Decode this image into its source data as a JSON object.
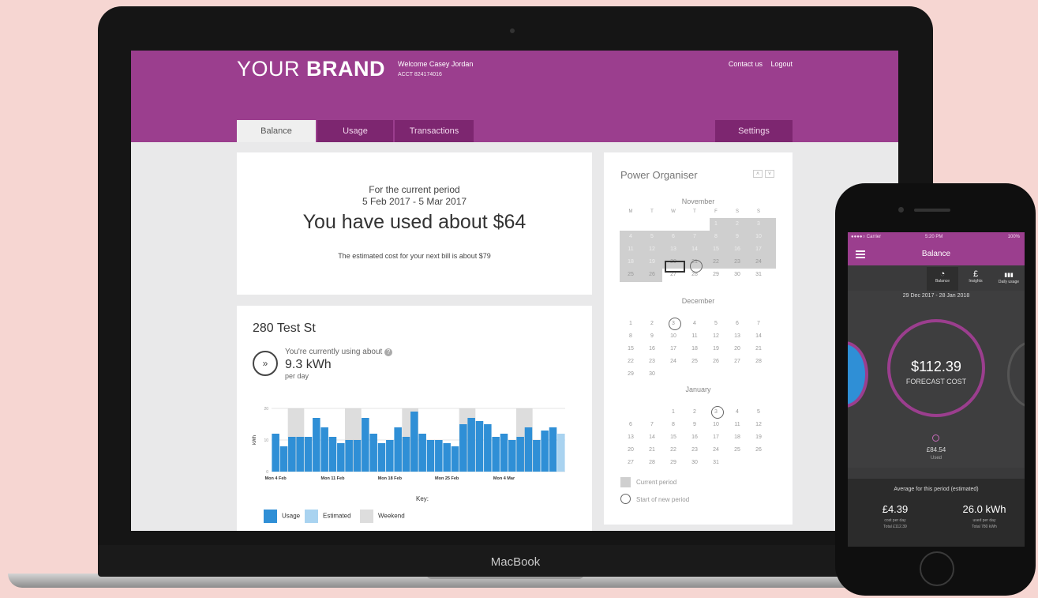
{
  "laptop": {
    "brand_label": "MacBook"
  },
  "site": {
    "brand_light": "YOUR",
    "brand_bold": "BRAND",
    "welcome": "Welcome Casey Jordan",
    "account": "ACCT 824174016",
    "links": [
      "Contact us",
      "Logout"
    ],
    "tabs": [
      "Balance",
      "Usage",
      "Transactions"
    ],
    "settings_tab": "Settings"
  },
  "period_card": {
    "label": "For the current period",
    "dates": "5 Feb 2017 - 5 Mar 2017",
    "headline": "You have used about $64",
    "estimate": "The estimated cost for your next bill is about $79"
  },
  "usage_card": {
    "address": "280 Test St",
    "currently_label": "You're currently using about",
    "arrow_icon": "»",
    "value": "9.3 kWh",
    "per": "per day",
    "legend_key": "Key:",
    "legend": [
      "Usage",
      "Estimated",
      "Weekend"
    ]
  },
  "chart_data": {
    "type": "bar",
    "ylabel": "kWh",
    "ylim": [
      0,
      20
    ],
    "yticks": [
      "20",
      "10",
      "0"
    ],
    "xticks": [
      "Mon 4 Feb",
      "Mon 11 Feb",
      "Mon 18 Feb",
      "Mon 25 Feb",
      "Mon 4 Mar"
    ],
    "values": [
      12,
      8,
      11,
      11,
      11,
      17,
      14,
      11,
      9,
      10,
      10,
      17,
      12,
      9,
      10,
      14,
      11,
      19,
      12,
      10,
      10,
      9,
      8,
      15,
      17,
      16,
      15,
      11,
      12,
      10,
      11,
      14,
      10,
      13,
      14,
      12
    ],
    "estimated_index": 35,
    "weekend_bands": [
      [
        2,
        3
      ],
      [
        9,
        10
      ],
      [
        16,
        17
      ],
      [
        23,
        24
      ],
      [
        30,
        31
      ]
    ],
    "colors": {
      "usage": "#2f8fd6",
      "estimated": "#a9d3f0",
      "weekend": "#dddddd"
    }
  },
  "calendar": {
    "title": "Power Organiser",
    "weekdays": [
      "M",
      "T",
      "W",
      "T",
      "F",
      "S",
      "S"
    ],
    "months": [
      {
        "name": "November",
        "rows": [
          [
            "",
            "",
            "",
            "",
            "1",
            "2",
            "3"
          ],
          [
            "4",
            "5",
            "6",
            "7",
            "8",
            "9",
            "10"
          ],
          [
            "11",
            "12",
            "13",
            "14",
            "15",
            "16",
            "17"
          ],
          [
            "18",
            "19",
            "20",
            "21",
            "22",
            "23",
            "24"
          ],
          [
            "25",
            "26",
            "27",
            "28",
            "29",
            "30",
            "31"
          ]
        ]
      },
      {
        "name": "December",
        "rows": [
          [
            "1",
            "2",
            "3",
            "4",
            "5",
            "6",
            "7"
          ],
          [
            "8",
            "9",
            "10",
            "11",
            "12",
            "13",
            "14"
          ],
          [
            "15",
            "16",
            "17",
            "18",
            "19",
            "20",
            "21"
          ],
          [
            "22",
            "23",
            "24",
            "25",
            "26",
            "27",
            "28"
          ],
          [
            "29",
            "30",
            "",
            "",
            "",
            "",
            ""
          ]
        ]
      },
      {
        "name": "January",
        "rows": [
          [
            "",
            "",
            "1",
            "2",
            "3",
            "4",
            "5"
          ],
          [
            "6",
            "7",
            "8",
            "9",
            "10",
            "11",
            "12"
          ],
          [
            "13",
            "14",
            "15",
            "16",
            "17",
            "18",
            "19"
          ],
          [
            "20",
            "21",
            "22",
            "23",
            "24",
            "25",
            "26"
          ],
          [
            "27",
            "28",
            "29",
            "30",
            "31",
            "",
            ""
          ]
        ]
      }
    ],
    "legend_current": "Current period",
    "legend_start": "Start of new period"
  },
  "phone": {
    "carrier": "●●●●○ Carrier",
    "time": "5:20 PM",
    "battery": "100%",
    "title": "Balance",
    "tabs": [
      {
        "label": "Balance",
        "glyph": "◔"
      },
      {
        "label": "Insights",
        "glyph": "£"
      },
      {
        "label": "Daily usage",
        "glyph": "▮▮▮"
      }
    ],
    "period": "29 Dec 2017 - 28 Jan 2018",
    "forecast_value": "$112.39",
    "forecast_label": "FORECAST COST",
    "used_value": "£84.54",
    "used_label": "Used",
    "avg_title": "Average for this period (estimated)",
    "cost_value": "£4.39",
    "cost_label": "cost per day",
    "cost_total": "Total £112.39",
    "kwh_value": "26.0 kWh",
    "kwh_label": "used per day",
    "kwh_total": "Total 780 kWh"
  },
  "colors": {
    "brand": "#9b3e8e",
    "background": "#f6d6d2",
    "chart_blue": "#2f8fd6"
  }
}
